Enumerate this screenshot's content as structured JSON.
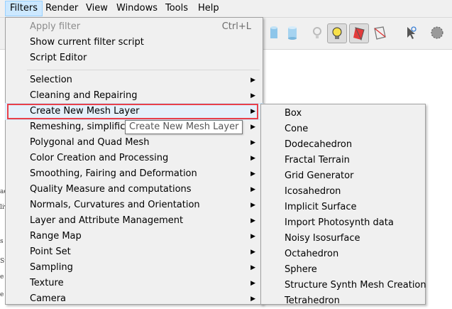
{
  "menubar": {
    "items": [
      "Filters",
      "Render",
      "View",
      "Windows",
      "Tools",
      "Help"
    ]
  },
  "filters_menu": {
    "top": [
      {
        "label": "Apply filter",
        "shortcut": "Ctrl+L",
        "disabled": true
      },
      {
        "label": "Show current filter script"
      },
      {
        "label": "Script Editor"
      }
    ],
    "categories": [
      "Selection",
      "Cleaning and Repairing",
      "Create New Mesh Layer",
      "Remeshing, simplification",
      "Polygonal and Quad Mesh",
      "Color Creation and Processing",
      "Smoothing, Fairing and Deformation",
      "Quality Measure and computations",
      "Normals, Curvatures and Orientation",
      "Layer and Attribute Management",
      "Range Map",
      "Point Set",
      "Sampling",
      "Texture",
      "Camera"
    ]
  },
  "tooltip": "Create New Mesh Layer",
  "submenu": {
    "items": [
      "Box",
      "Cone",
      "Dodecahedron",
      "Fractal Terrain",
      "Grid Generator",
      "Icosahedron",
      "Implicit Surface",
      "Import Photosynth data",
      "Noisy Isosurface",
      "Octahedron",
      "Sphere",
      "Structure Synth Mesh Creation",
      "Tetrahedron"
    ]
  },
  "left_strip_glyphs": [
    "ac",
    "liv",
    "s",
    "Su",
    "e",
    "e"
  ],
  "colors": {
    "highlight_box": "#e8404a",
    "menu_bg": "#f0f0f0",
    "active_menu": "#cce8ff"
  }
}
